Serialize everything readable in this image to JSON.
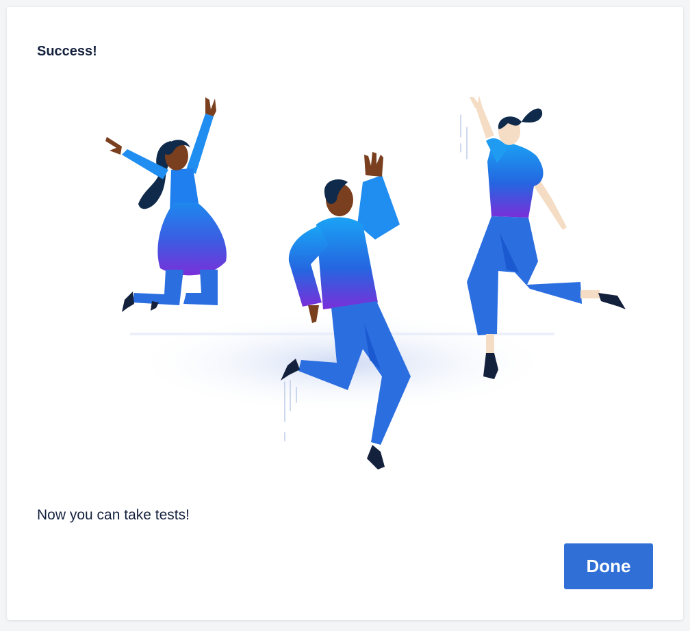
{
  "dialog": {
    "title": "Success!",
    "message": "Now you can take tests!",
    "done_label": "Done"
  },
  "illustration": {
    "subject": "three-people-jumping-celebration"
  },
  "colors": {
    "button_bg": "#2f6fd6",
    "text_dark": "#14213d",
    "shirt_top": "#1aa3f5",
    "shirt_bottom": "#7a2fd9",
    "pants": "#2b6ee0",
    "dark_skin": "#7a3f1e",
    "light_skin": "#f5dcc4",
    "hair": "#0f2a4a"
  }
}
